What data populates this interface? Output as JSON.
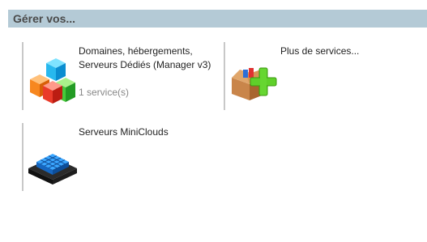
{
  "section": {
    "title": "Gérer vos..."
  },
  "tiles": [
    {
      "label": "Domaines, hébergements,\nServeurs Dédiés (Manager v3)",
      "count": "1 service(s)",
      "icon": "colored-cubes-icon"
    },
    {
      "label": "Plus de services...",
      "icon": "box-plus-icon"
    },
    {
      "label": "Serveurs MiniClouds",
      "icon": "server-grid-icon"
    }
  ],
  "colors": {
    "header_bg": "#b4cad6",
    "divider": "#c8c8c8"
  }
}
